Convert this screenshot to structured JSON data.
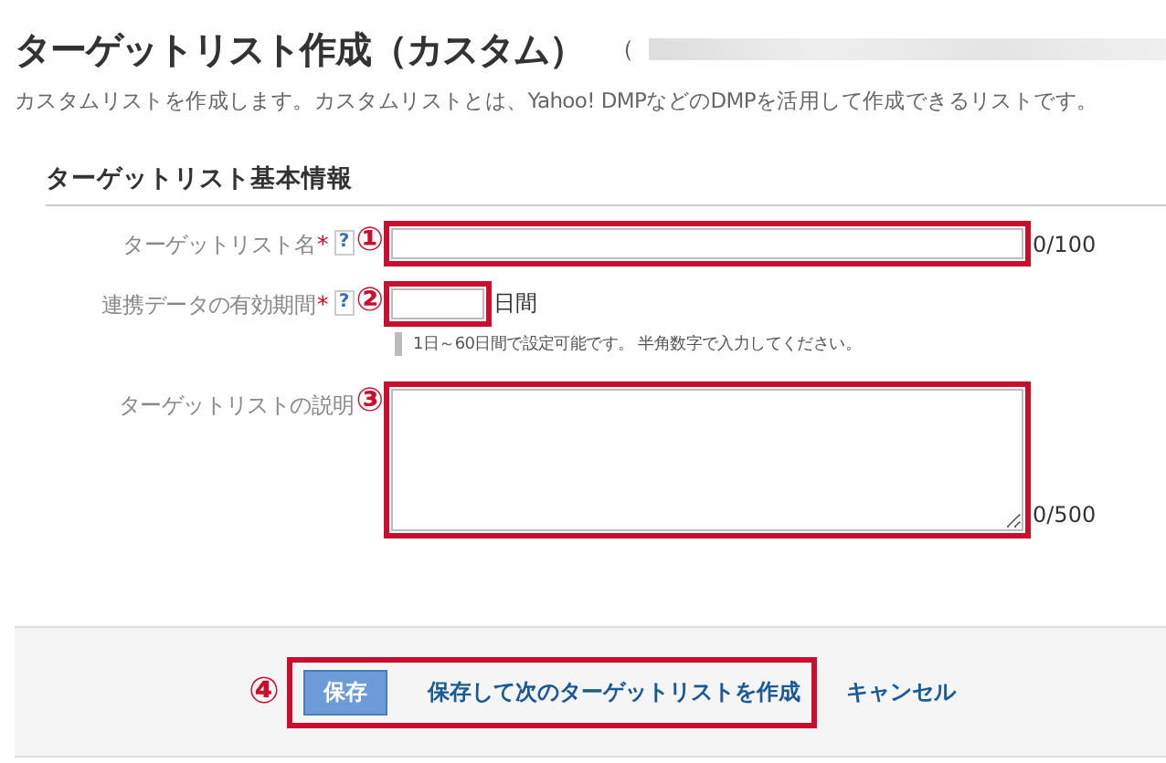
{
  "page": {
    "title": "ターゲットリスト作成（カスタム）",
    "title_suffix": "（",
    "description": "カスタムリストを作成します。カスタムリストとは、Yahoo! DMPなどのDMPを活用して作成できるリストです。"
  },
  "section": {
    "heading": "ターゲットリスト基本情報"
  },
  "fields": [
    {
      "kind": "text",
      "label": "ターゲットリスト名",
      "required_mark": "*",
      "help_icon": "?",
      "marker": "①",
      "counter": "0/100"
    },
    {
      "kind": "days",
      "label": "連携データの有効期間",
      "required_mark": "*",
      "help_icon": "?",
      "marker": "②",
      "unit": "日間",
      "hint": "1日～60日間で設定可能です。 半角数字で入力してください。"
    },
    {
      "kind": "textarea",
      "label": "ターゲットリストの説明",
      "marker": "③",
      "counter": "0/500"
    }
  ],
  "footer": {
    "marker": "④",
    "save": "保存",
    "save_next": "保存して次のターゲットリストを作成",
    "cancel": "キャンセル"
  }
}
